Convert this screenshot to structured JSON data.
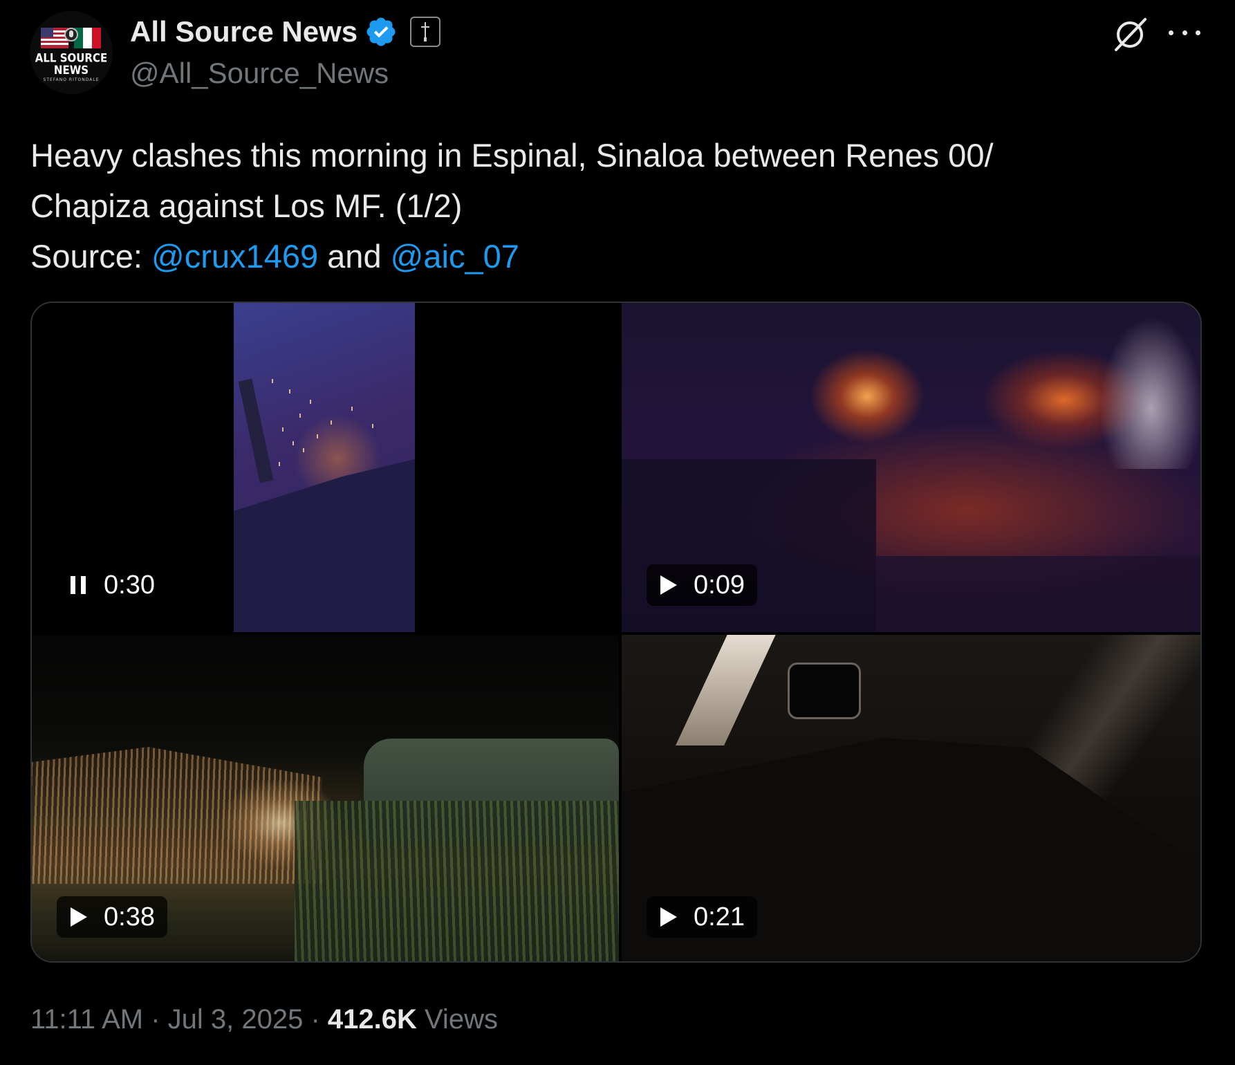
{
  "author": {
    "display_name": "All Source News",
    "handle": "@All_Source_News",
    "avatar_text": "ALL SOURCE NEWS",
    "avatar_subtext": "STEFANO RITONDALE",
    "verified_color": "#1d9bf0"
  },
  "tweet": {
    "text_line1": "Heavy clashes this morning in Espinal, Sinaloa between Renes 00/",
    "text_line2": "Chapiza against Los MF. (1/2)",
    "source_label": "Source: ",
    "mention1": "@crux1469",
    "connector": " and ",
    "mention2": "@aic_07"
  },
  "media": [
    {
      "duration": "0:30",
      "state": "pause-icon"
    },
    {
      "duration": "0:09",
      "state": "play-icon"
    },
    {
      "duration": "0:38",
      "state": "play-icon"
    },
    {
      "duration": "0:21",
      "state": "play-icon"
    }
  ],
  "meta": {
    "time": "11:11 AM",
    "separator": " · ",
    "date": "Jul 3, 2025",
    "views_count": "412.6K",
    "views_label": " Views"
  },
  "colors": {
    "background": "#000000",
    "text": "#e7e9ea",
    "muted": "#71767b",
    "link": "#1d9bf0"
  }
}
